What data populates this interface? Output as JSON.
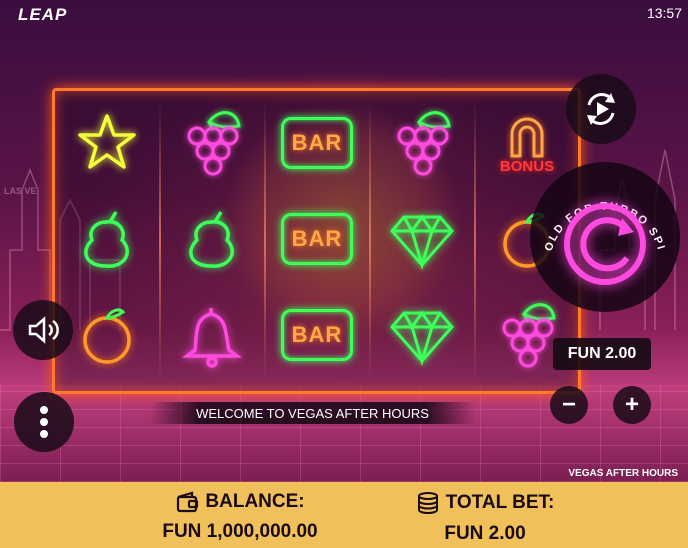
{
  "header": {
    "logo": "LEAP",
    "clock": "13:57"
  },
  "reels": {
    "rows": [
      [
        "star",
        "grapes",
        "bar",
        "grapes",
        "horseshoe-bonus"
      ],
      [
        "pear",
        "pear",
        "bar",
        "diamond",
        "orange"
      ],
      [
        "orange",
        "bell",
        "bar",
        "diamond",
        "grapes"
      ]
    ],
    "bar_label": "BAR",
    "bonus_label": "BONUS"
  },
  "controls": {
    "turbo_hint": "HOLD FOR TURBO SPIN",
    "bet_display": "FUN 2.00",
    "decrease_label": "−",
    "increase_label": "+"
  },
  "background": {
    "sign_text": "LAS VE"
  },
  "message": "WELCOME TO VEGAS AFTER HOURS",
  "game_name": "VEGAS AFTER HOURS",
  "footer": {
    "balance_label": "BALANCE:",
    "balance_value": "FUN 1,000,000.00",
    "total_bet_label": "TOTAL BET:",
    "total_bet_value": "FUN 2.00"
  },
  "colors": {
    "frame": "#ff7a2a",
    "neon_green": "#3cff5a",
    "neon_pink": "#ff4ae0",
    "neon_orange": "#ffa84a",
    "neon_yellow": "#f4ff3a",
    "footer_bg": "#f0c05a"
  }
}
